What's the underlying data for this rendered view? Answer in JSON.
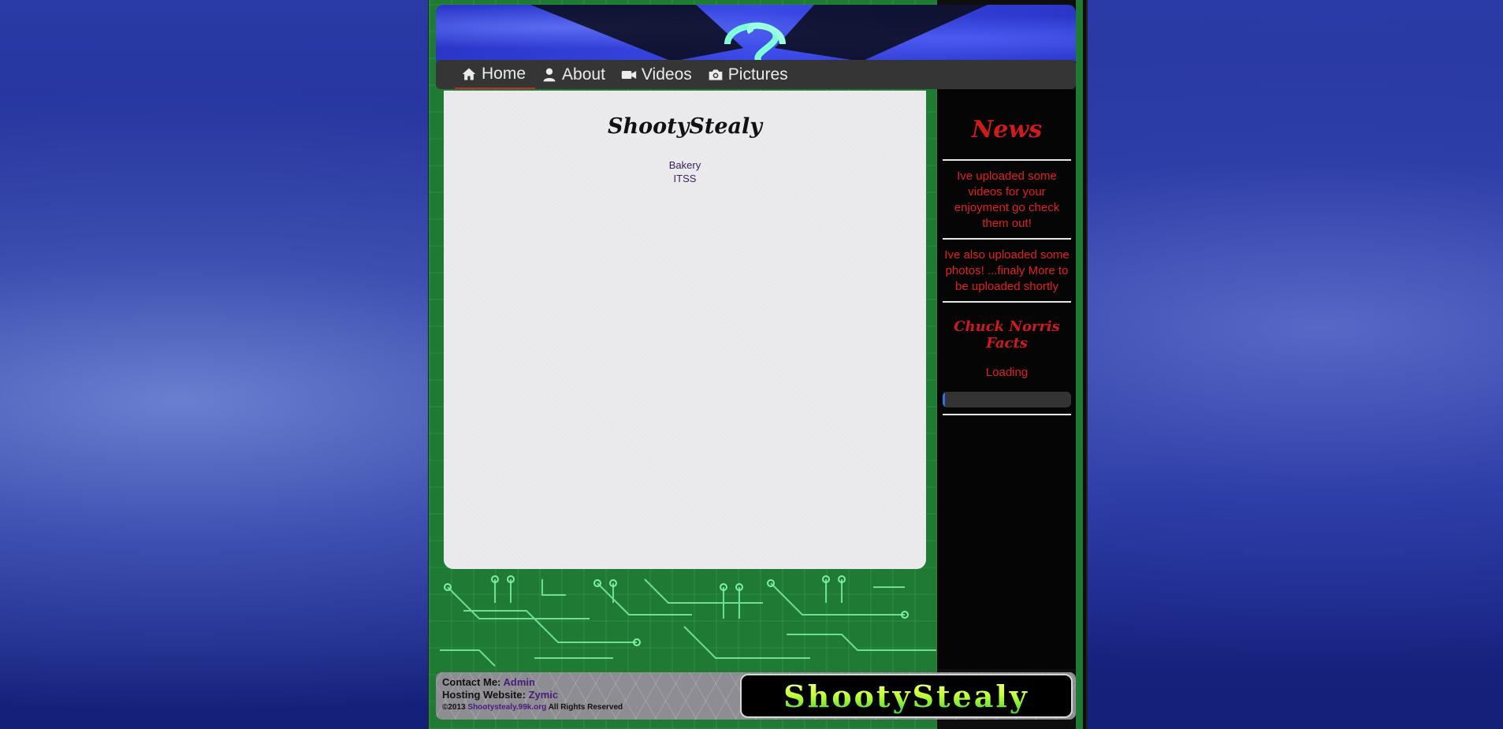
{
  "nav": {
    "items": [
      {
        "label": "Home",
        "icon": "home-icon",
        "active": true
      },
      {
        "label": "About",
        "icon": "user-icon",
        "active": false
      },
      {
        "label": "Videos",
        "icon": "video-camera-icon",
        "active": false
      },
      {
        "label": "Pictures",
        "icon": "camera-icon",
        "active": false
      }
    ]
  },
  "main": {
    "title": "ShootyStealy",
    "links": [
      "Bakery",
      "ITSS"
    ]
  },
  "sidebar": {
    "heading": "News",
    "items": [
      "Ive uploaded some videos for your enjoyment go check them out!",
      "Ive also uploaded some photos! ...finaly More to be uploaded shortly"
    ],
    "facts_heading": "Chuck Norris Facts",
    "loading_text": "Loading",
    "progress": 0.02
  },
  "footer": {
    "contact_label": "Contact Me:",
    "contact_link": "Admin",
    "hosting_label": "Hosting Website:",
    "hosting_link": "Zymic",
    "copyright_prefix": "©2013",
    "copyright_link": "Shootystealy.99k.org",
    "copyright_suffix": "All Rights Reserved",
    "logo_text": "ShootyStealy"
  },
  "colors": {
    "accent_red": "#d11a1a",
    "nav_bg": "#353535",
    "circuit_green": "#1f7a34",
    "link_purple": "#4a1c7a"
  }
}
